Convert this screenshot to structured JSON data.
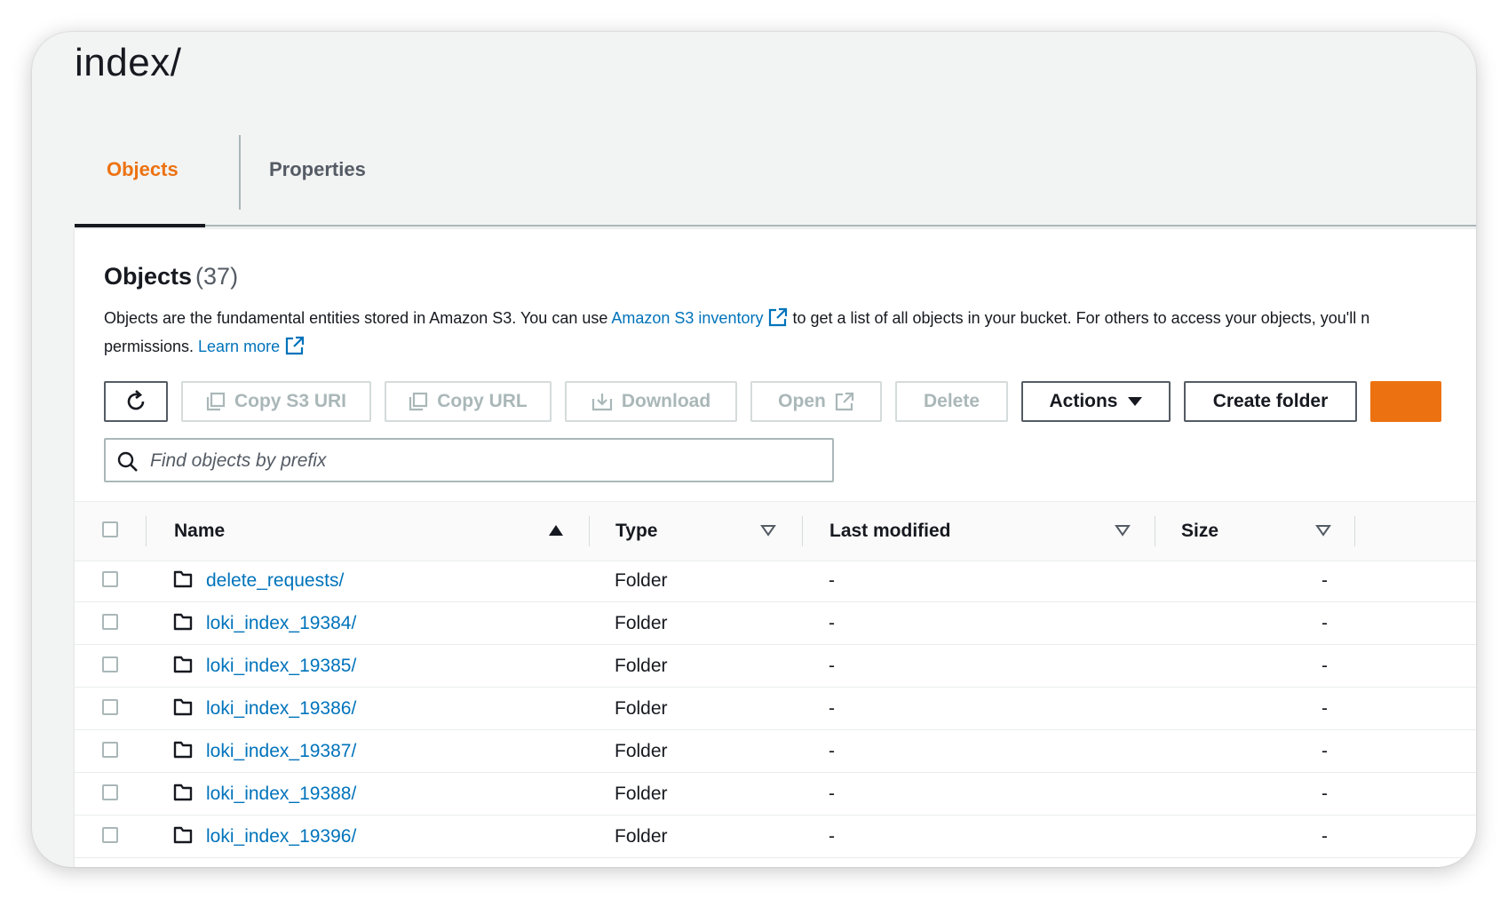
{
  "page": {
    "title": "index/"
  },
  "tabs": [
    {
      "label": "Objects",
      "active": true
    },
    {
      "label": "Properties",
      "active": false
    }
  ],
  "panel": {
    "heading": "Objects",
    "count": "(37)",
    "desc_part1": "Objects are the fundamental entities stored in Amazon S3. You can use ",
    "desc_link1": "Amazon S3 inventory",
    "desc_part2": " to get a list of all objects in your bucket. For others to access your objects, you'll n",
    "desc_part3": "permissions. ",
    "desc_link2": "Learn more"
  },
  "toolbar": {
    "refresh_icon": "refresh-icon",
    "copy_s3_uri": "Copy S3 URI",
    "copy_url": "Copy URL",
    "download": "Download",
    "open": "Open",
    "delete": "Delete",
    "actions": "Actions",
    "create_folder": "Create folder"
  },
  "search": {
    "placeholder": "Find objects by prefix",
    "value": ""
  },
  "table": {
    "columns": {
      "name": "Name",
      "type": "Type",
      "last_modified": "Last modified",
      "size": "Size"
    },
    "sort": {
      "column": "Name",
      "direction": "ascending"
    },
    "rows": [
      {
        "name": "delete_requests/",
        "type": "Folder",
        "last_modified": "-",
        "size": "-"
      },
      {
        "name": "loki_index_19384/",
        "type": "Folder",
        "last_modified": "-",
        "size": "-"
      },
      {
        "name": "loki_index_19385/",
        "type": "Folder",
        "last_modified": "-",
        "size": "-"
      },
      {
        "name": "loki_index_19386/",
        "type": "Folder",
        "last_modified": "-",
        "size": "-"
      },
      {
        "name": "loki_index_19387/",
        "type": "Folder",
        "last_modified": "-",
        "size": "-"
      },
      {
        "name": "loki_index_19388/",
        "type": "Folder",
        "last_modified": "-",
        "size": "-"
      },
      {
        "name": "loki_index_19396/",
        "type": "Folder",
        "last_modified": "-",
        "size": "-"
      }
    ]
  },
  "colors": {
    "accent": "#ec7211",
    "link": "#0073bb",
    "text": "#16191f",
    "disabled": "#aab7b8"
  }
}
